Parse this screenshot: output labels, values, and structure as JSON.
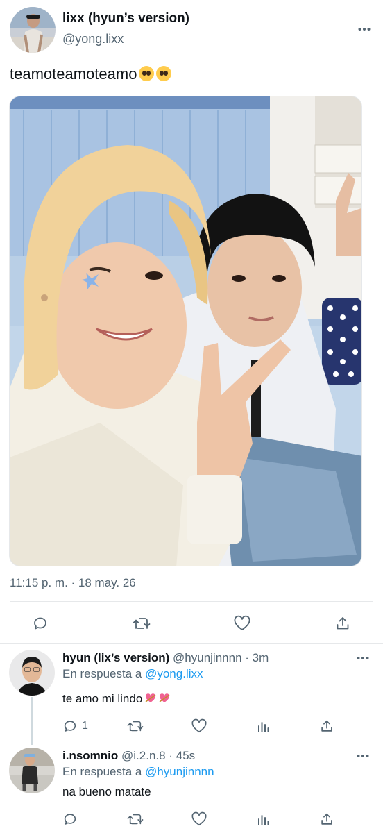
{
  "main_tweet": {
    "author_name": "lixx (hyun’s version)",
    "author_handle": "@yong.lixx",
    "text": "teamoteamoteamo",
    "text_emojis": [
      "pleading-face-emoji",
      "pleading-face-emoji"
    ],
    "timestamp": "11:15 p. m. · 18 may. 26",
    "more_icon": "more-dots-icon",
    "actions": [
      "reply-icon",
      "retweet-icon",
      "like-icon",
      "share-icon"
    ]
  },
  "replies": [
    {
      "author_name": "hyun (lix’s version)",
      "author_handle": "@hyunjinnnn",
      "separator": "·",
      "time": "3m",
      "reply_prefix": "En respuesta a",
      "reply_to": "@yong.lixx",
      "text": "te amo mi lindo",
      "text_emojis": [
        "heart-with-arrow-emoji",
        "heart-with-arrow-emoji"
      ],
      "reply_count": "1",
      "actions": [
        "reply-icon",
        "retweet-icon",
        "like-icon",
        "analytics-icon",
        "share-icon"
      ]
    },
    {
      "author_name": "i.nsomnio",
      "author_handle": "@i.2.n.8",
      "separator": "·",
      "time": "45s",
      "reply_prefix": "En respuesta a",
      "reply_to": "@hyunjinnnn",
      "text": "na bueno matate",
      "reply_count": "",
      "actions": [
        "reply-icon",
        "retweet-icon",
        "like-icon",
        "analytics-icon",
        "share-icon"
      ]
    }
  ],
  "colors": {
    "text": "#0f1419",
    "secondary": "#536471",
    "link": "#1d9bf0",
    "divider": "#e6e8ea"
  }
}
